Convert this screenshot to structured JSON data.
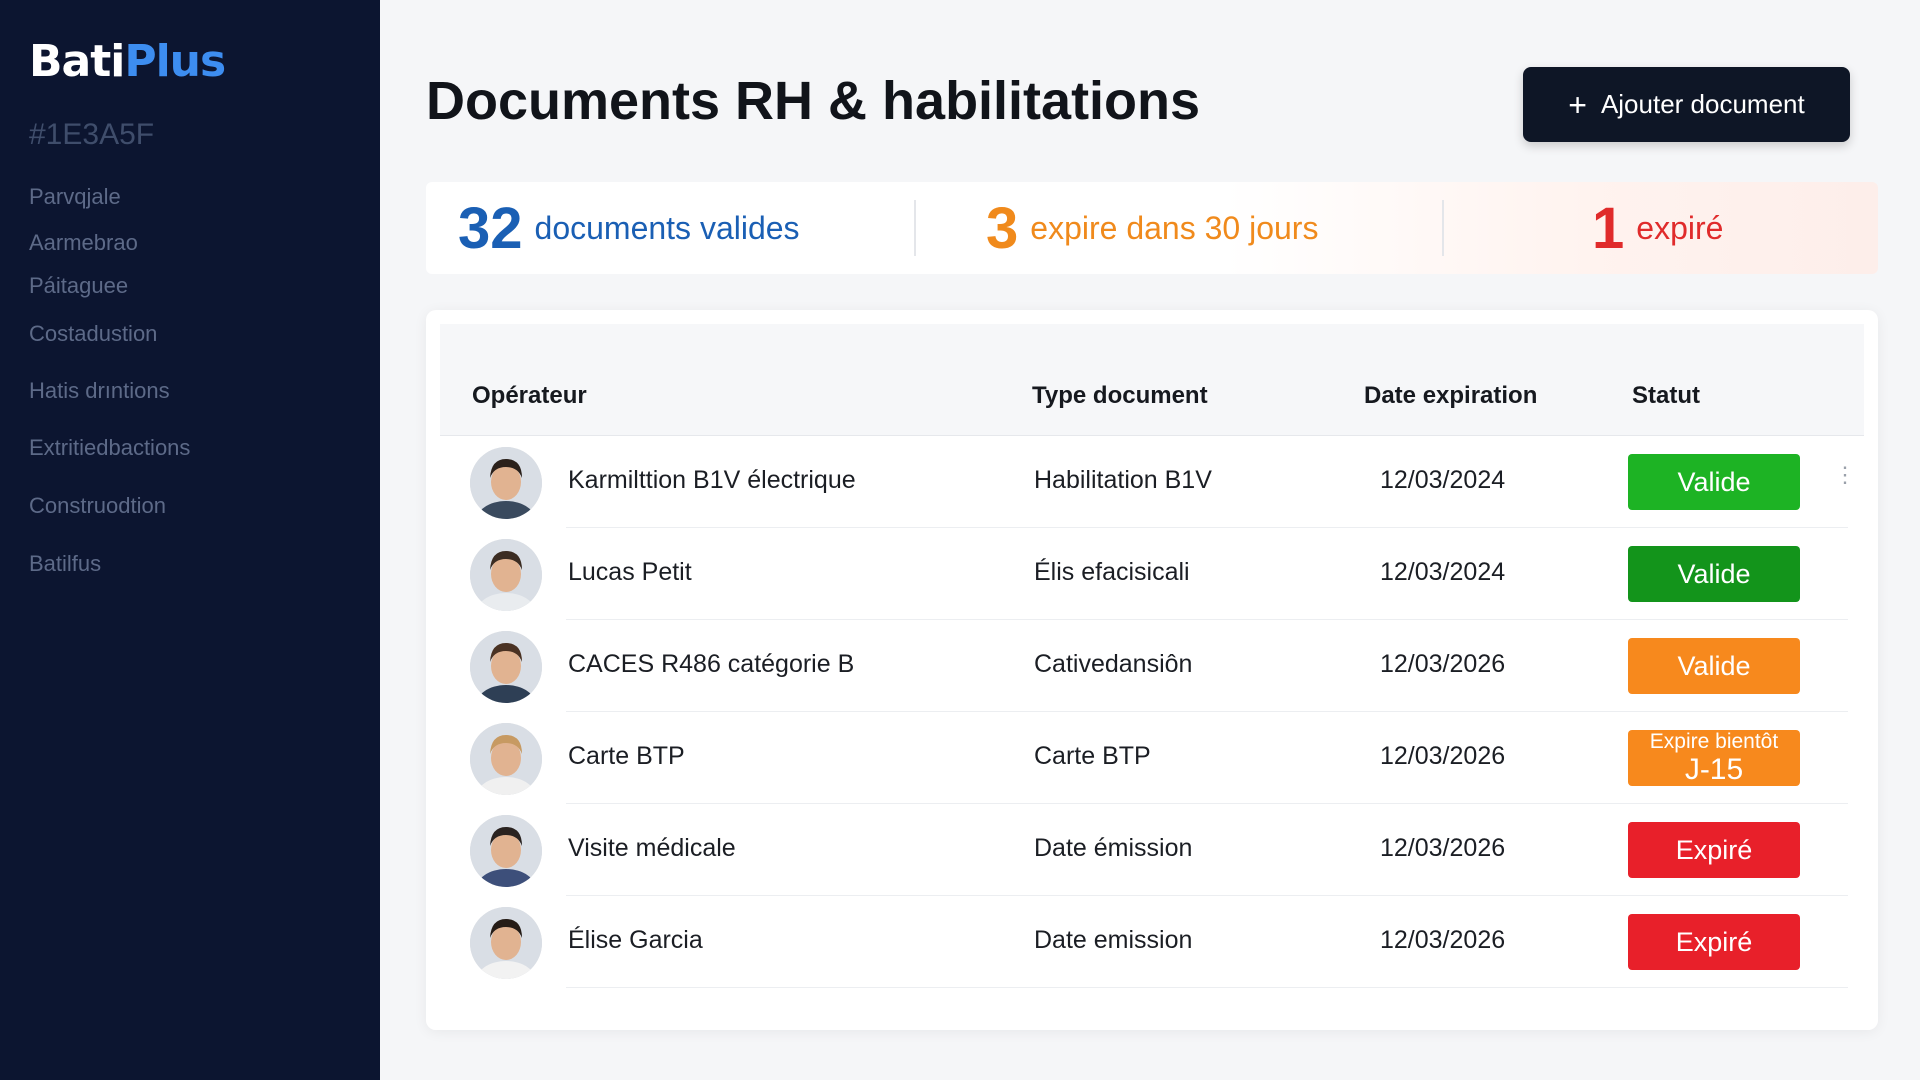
{
  "sidebar": {
    "logo_part1": "Bati",
    "logo_part2": "Plus",
    "hex_label": "#1E3A5F",
    "items": [
      {
        "label": "Parvqjale"
      },
      {
        "label": "Aarmebrao"
      },
      {
        "label": "Páitaguee"
      },
      {
        "label": "Costadustion"
      },
      {
        "label": "Hatis drıntions"
      },
      {
        "label": "Extritiedbactions"
      },
      {
        "label": "Construodtion"
      },
      {
        "label": "Batilfus"
      }
    ]
  },
  "header": {
    "title": "Documents RH & habilitations",
    "add_button_icon": "+",
    "add_button_label": "Ajouter document"
  },
  "stats": [
    {
      "number": "32",
      "label": "documents valides",
      "color": "#1a5fb4"
    },
    {
      "number": "3",
      "label": "expire dans 30 jours",
      "color": "#f08a1c"
    },
    {
      "number": "1",
      "label": "expiré",
      "color": "#e02b2b"
    }
  ],
  "table": {
    "headers": {
      "operator": "Opérateur",
      "type": "Type document",
      "date": "Date expiration",
      "status": "Statut"
    },
    "rows": [
      {
        "operator": "Karmilttion B1V électrique",
        "type": "Habilitation B1V",
        "date": "12/03/2024",
        "status": "Valide",
        "status_line2": "",
        "status_color": "#1db324",
        "menu_icon": "⋮"
      },
      {
        "operator": "Lucas Petit",
        "type": "Élis efacisicali",
        "date": "12/03/2024",
        "status": "Valide",
        "status_line2": "",
        "status_color": "#13941b",
        "menu_icon": ""
      },
      {
        "operator": "CACES R486 catégorie B",
        "type": "Cativedansiôn",
        "date": "12/03/2026",
        "status": "Valide",
        "status_line2": "",
        "status_color": "#f7891d",
        "menu_icon": ""
      },
      {
        "operator": "Carte BTP",
        "type": "Carte BTP",
        "date": "12/03/2026",
        "status": "Expire bientôt",
        "status_line2": "J-15",
        "status_color": "#f7891d",
        "menu_icon": ""
      },
      {
        "operator": "Visite médicale",
        "type": "Date émission",
        "date": "12/03/2026",
        "status": "Expiré",
        "status_line2": "",
        "status_color": "#e8202a",
        "menu_icon": ""
      },
      {
        "operator": "Élise Garcia",
        "type": "Date emission",
        "date": "12/03/2026",
        "status": "Expiré",
        "status_line2": "",
        "status_color": "#e8202a",
        "menu_icon": ""
      }
    ]
  }
}
